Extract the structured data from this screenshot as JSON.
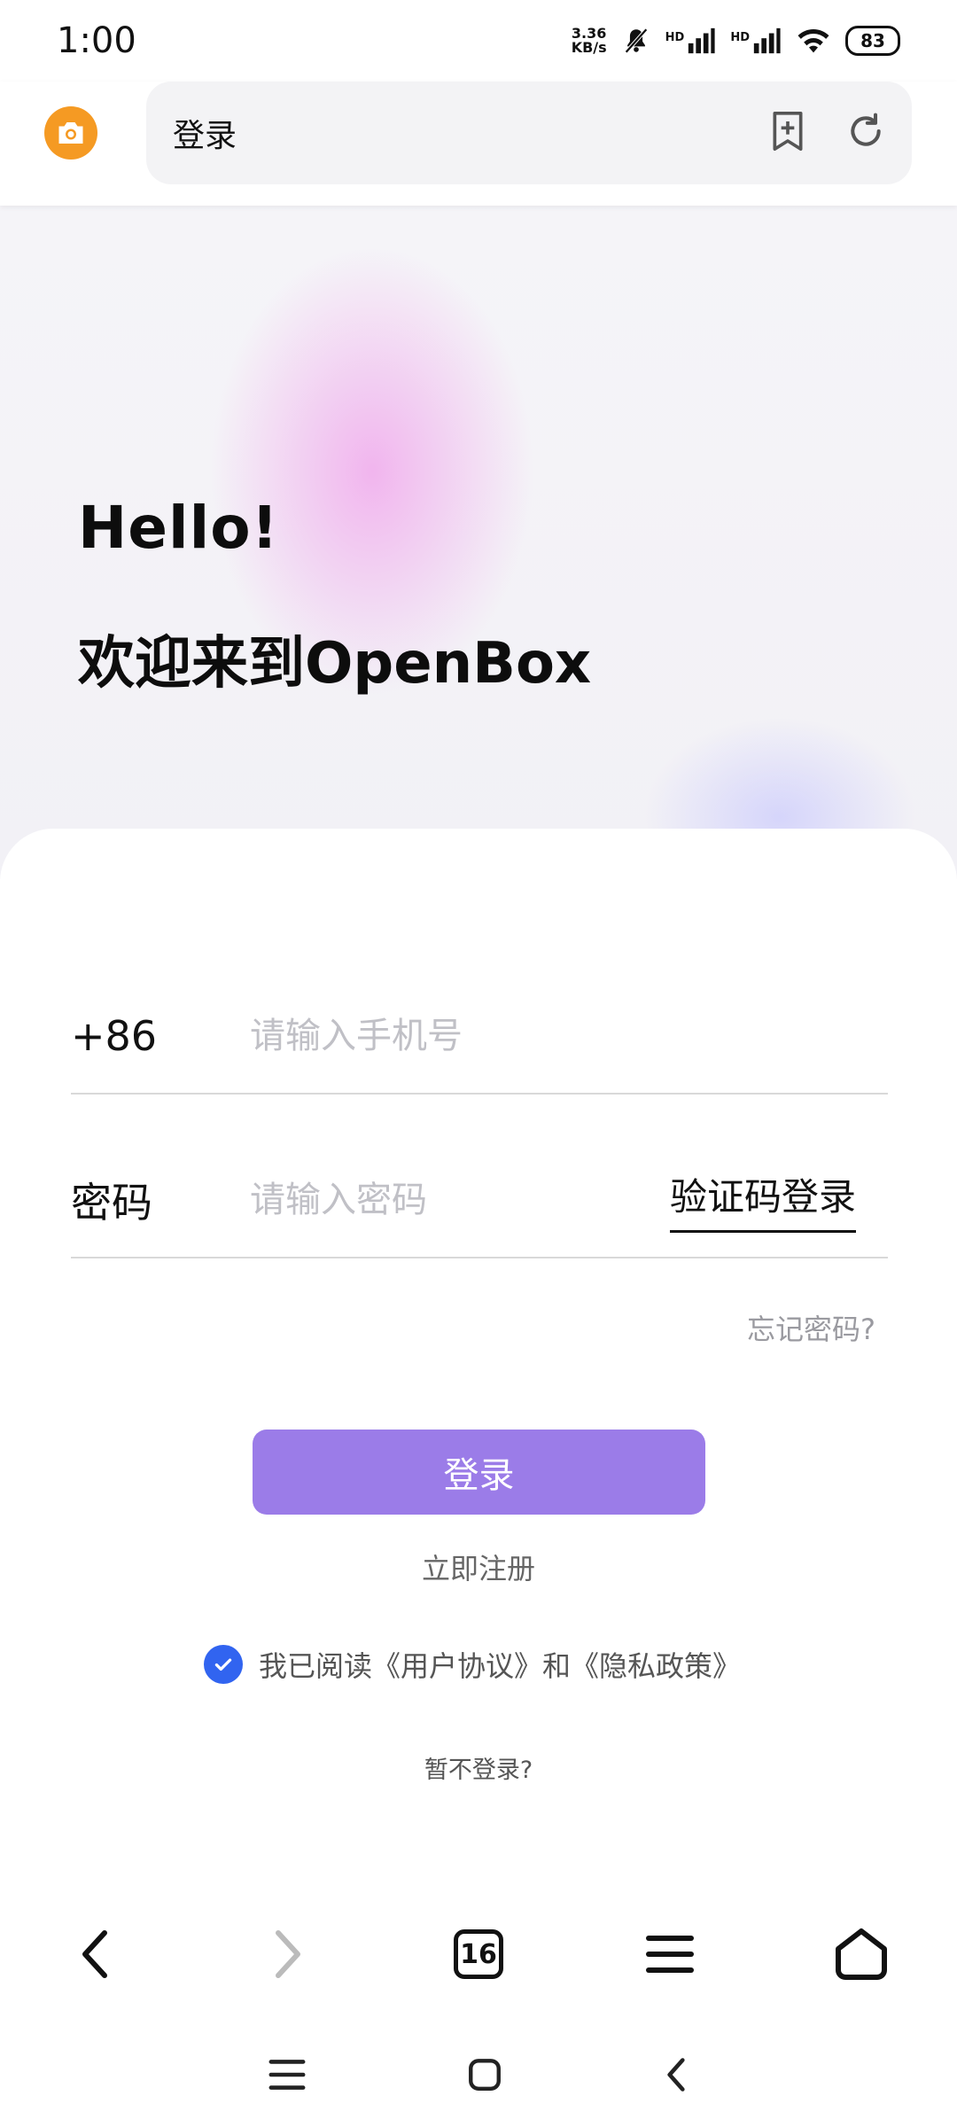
{
  "status_bar": {
    "time": "1:00",
    "net_speed_top": "3.36",
    "net_speed_bottom": "KB/s",
    "hd1": "HD",
    "hd2": "HD",
    "battery": "83"
  },
  "browser": {
    "url_title": "登录",
    "icons": [
      "camera-icon",
      "bookmark-add-icon",
      "refresh-icon"
    ]
  },
  "hero": {
    "title": "Hello!",
    "subtitle": "欢迎来到OpenBox"
  },
  "form": {
    "country_code": "+86",
    "phone_placeholder": "请输入手机号",
    "password_label": "密码",
    "password_placeholder": "请输入密码",
    "sms_login": "验证码登录",
    "forgot_password": "忘记密码?",
    "login_button": "登录",
    "register": "立即注册",
    "agreement": "我已阅读《用户协议》和《隐私政策》",
    "agreement_checked": true,
    "skip_login": "暂不登录?"
  },
  "colors": {
    "accent": "#9b7ce8",
    "checkbox": "#3164f0",
    "camera": "#f59a23"
  },
  "bottom_nav": {
    "tab_count": "16",
    "icons": [
      "back-icon",
      "forward-icon",
      "tabs-icon",
      "menu-icon",
      "home-icon"
    ]
  },
  "system_nav": {
    "icons": [
      "recents-icon",
      "home-square-icon",
      "system-back-icon"
    ]
  }
}
